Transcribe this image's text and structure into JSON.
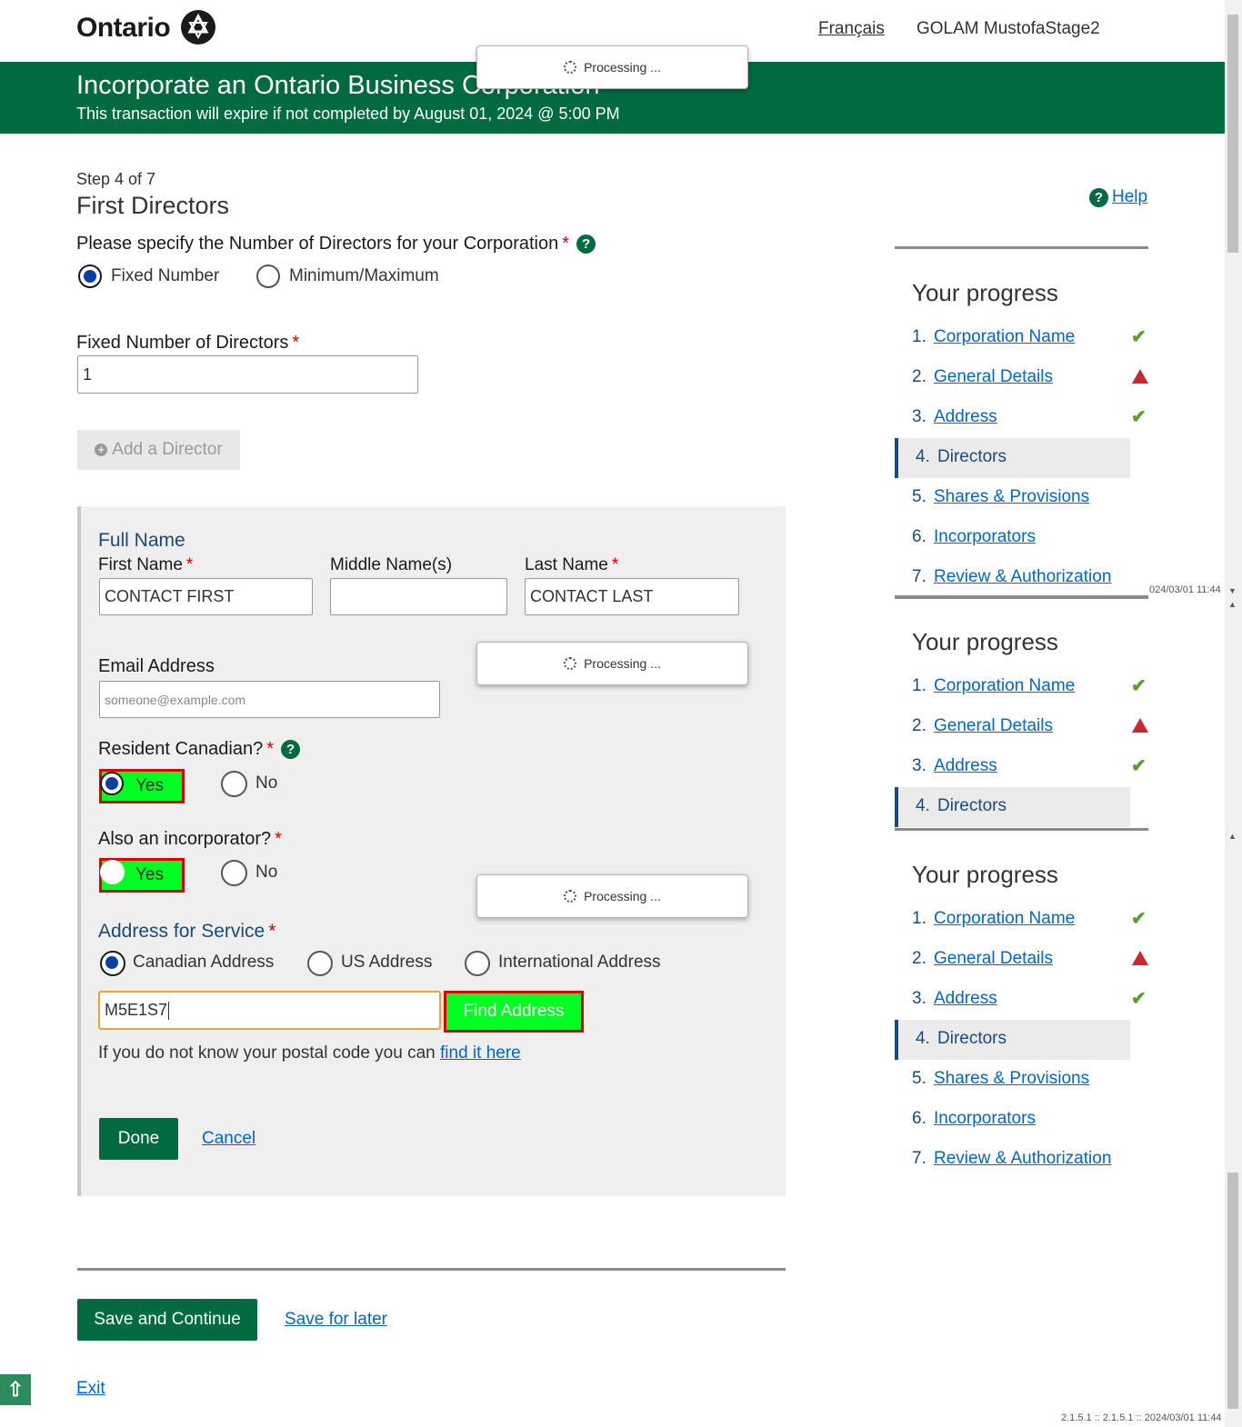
{
  "header": {
    "logo_text": "Ontario",
    "lang_link": "Français",
    "user_name": "GOLAM MustofaStage2"
  },
  "banner": {
    "title": "Incorporate an Ontario Business Corporation",
    "subtitle": "This transaction will expire if not completed by August 01, 2024 @ 5:00 PM"
  },
  "processing": {
    "label": "Processing ..."
  },
  "page": {
    "step": "Step 4 of 7",
    "title": "First Directors",
    "help": "Help"
  },
  "directors_count": {
    "question": "Please specify the Number of Directors for your Corporation",
    "option_fixed": "Fixed Number",
    "option_minmax": "Minimum/Maximum",
    "selected": "Fixed Number",
    "fixed_label": "Fixed Number of Directors",
    "fixed_value": "1",
    "add_director": "Add a Director"
  },
  "director_form": {
    "full_name_heading": "Full Name",
    "first_name_label": "First Name",
    "first_name_value": "CONTACT FIRST",
    "middle_name_label": "Middle Name(s)",
    "middle_name_value": "",
    "last_name_label": "Last Name",
    "last_name_value": "CONTACT LAST",
    "email_label": "Email Address",
    "email_placeholder": "someone@example.com",
    "resident_label": "Resident Canadian?",
    "incorporator_label": "Also an incorporator?",
    "yes": "Yes",
    "no": "No",
    "address_heading": "Address for Service",
    "addr_canadian": "Canadian Address",
    "addr_us": "US Address",
    "addr_international": "International Address",
    "postal_value": "M5E1S7",
    "find_address": "Find Address",
    "postal_hint": "If you do not know your postal code you can",
    "postal_link": "find it here",
    "done": "Done",
    "cancel": "Cancel"
  },
  "footer": {
    "save_continue": "Save and Continue",
    "save_later": "Save for later",
    "exit": "Exit",
    "version": "2.1.5.1 :: 2.1.5.1 :: 2024/03/01 11:44",
    "version_clipped": "024/03/01 11:44"
  },
  "progress": {
    "title": "Your progress",
    "items": [
      {
        "num": "1.",
        "label": "Corporation Name",
        "status": "complete"
      },
      {
        "num": "2.",
        "label": "General Details",
        "status": "warning"
      },
      {
        "num": "3.",
        "label": "Address",
        "status": "complete"
      },
      {
        "num": "4.",
        "label": "Directors",
        "status": "current"
      },
      {
        "num": "5.",
        "label": "Shares & Provisions",
        "status": "none"
      },
      {
        "num": "6.",
        "label": "Incorporators",
        "status": "none"
      },
      {
        "num": "7.",
        "label": "Review & Authorization",
        "status": "none"
      }
    ]
  },
  "colors": {
    "ontario_green": "#006b3f",
    "highlight_green": "#00ff22",
    "highlight_red": "#e00000",
    "link_blue": "#0066cc",
    "check_green": "#5a9e2f",
    "warn_red": "#c8272d"
  }
}
